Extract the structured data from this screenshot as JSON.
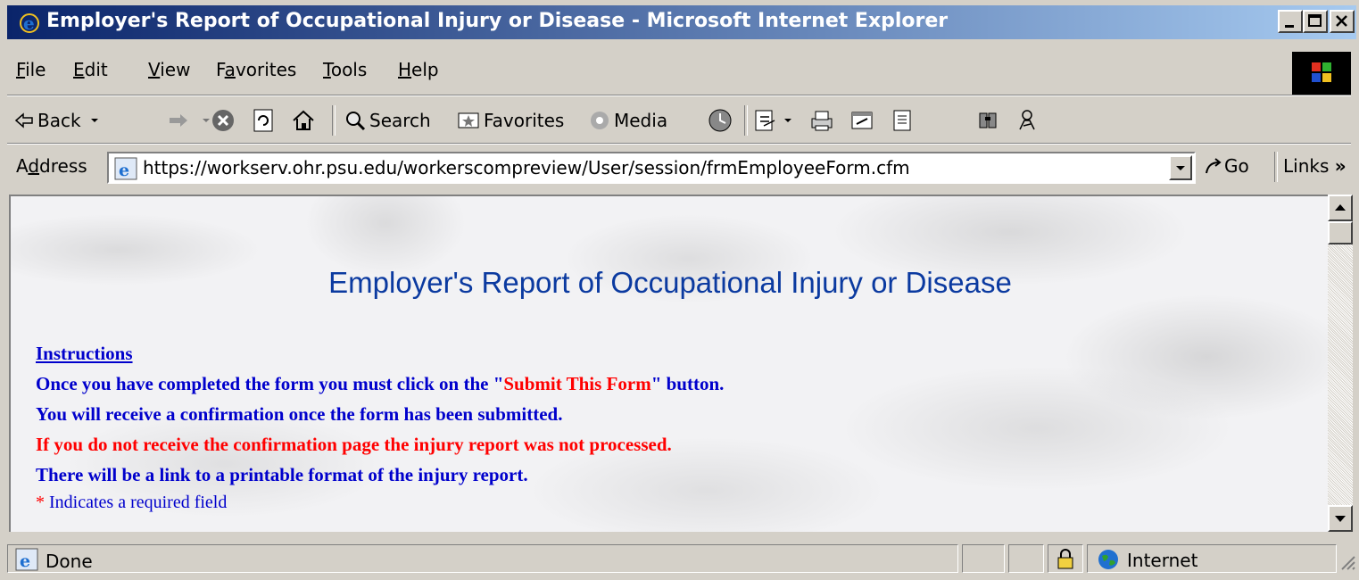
{
  "window": {
    "title": "Employer's Report of Occupational Injury or Disease - Microsoft Internet Explorer",
    "controls": [
      "minimize-icon",
      "maximize-icon",
      "close-icon"
    ]
  },
  "menu": {
    "file": {
      "acc": "F",
      "rest": "ile"
    },
    "edit": {
      "acc": "E",
      "rest": "dit"
    },
    "view": {
      "acc": "V",
      "rest": "iew"
    },
    "favorites": {
      "pre": "F",
      "acc": "a",
      "rest": "vorites"
    },
    "tools": {
      "acc": "T",
      "rest": "ools"
    },
    "help": {
      "acc": "H",
      "rest": "elp"
    }
  },
  "toolbar": {
    "back": "Back",
    "search": "Search",
    "favorites": "Favorites",
    "media": "Media"
  },
  "address": {
    "label_pre": "A",
    "label_acc": "d",
    "label_rest": "dress",
    "url": "https://workserv.ohr.psu.edu/workerscompreview/User/session/frmEmployeeForm.cfm",
    "go": "Go",
    "links": "Links",
    "links_chevron": "»"
  },
  "page": {
    "heading": "Employer's Report of Occupational Injury or Disease",
    "instructions_title": "Instructions",
    "line1_pre": "Once you have completed the form you must click on the \"",
    "line1_highlight": "Submit This Form",
    "line1_post": "\" button.",
    "line2": "You will receive a confirmation once the form has been submitted.",
    "line3": "If you do not receive the confirmation page the injury report was not processed.",
    "line4": "There will be a link to a printable format of the injury report.",
    "required_star": "*",
    "required_text": " Indicates a required field"
  },
  "status": {
    "text": "Done",
    "zone": "Internet"
  },
  "colors": {
    "title_bar": "#0a246a",
    "heading": "#0b3aa0",
    "instruction_blue": "#0000cc",
    "instruction_red": "#ff0000"
  }
}
